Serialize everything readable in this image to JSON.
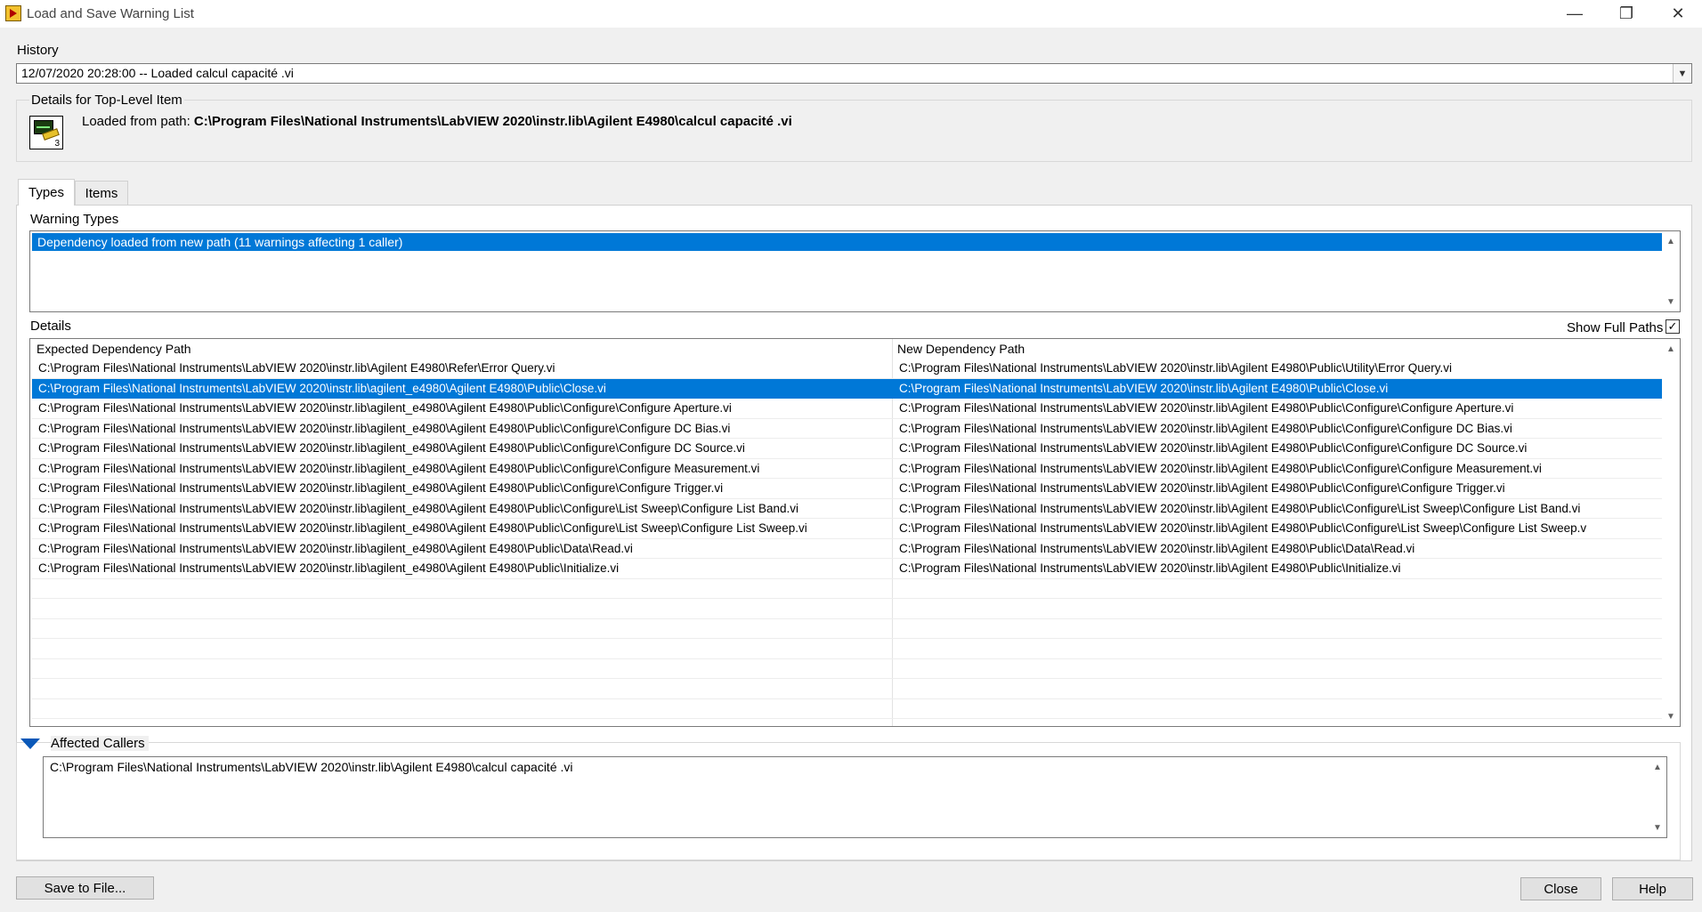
{
  "window": {
    "title": "Load and Save Warning List",
    "minimize_glyph": "—",
    "restore_glyph": "❐",
    "close_glyph": "✕"
  },
  "history": {
    "label": "History",
    "selected": "12/07/2020 20:28:00 -- Loaded calcul capacité .vi"
  },
  "top_level": {
    "label": "Details for Top-Level Item",
    "loaded_prefix": "Loaded from path: ",
    "path": "C:\\Program Files\\National Instruments\\LabVIEW 2020\\instr.lib\\Agilent E4980\\calcul capacité .vi",
    "icon_number": "3"
  },
  "tabs": [
    {
      "label": "Types",
      "selected": true
    },
    {
      "label": "Items",
      "selected": false
    }
  ],
  "warning_types": {
    "label": "Warning Types",
    "items": [
      "Dependency loaded from new path (11 warnings affecting 1 caller)"
    ]
  },
  "details": {
    "label": "Details",
    "show_full_paths_label": "Show Full Paths",
    "show_full_paths_checked": "✓",
    "columns": [
      "Expected Dependency Path",
      "New Dependency Path"
    ],
    "selected_row": 1,
    "rows": [
      [
        "C:\\Program Files\\National Instruments\\LabVIEW 2020\\instr.lib\\Agilent E4980\\Refer\\Error Query.vi",
        "C:\\Program Files\\National Instruments\\LabVIEW 2020\\instr.lib\\Agilent E4980\\Public\\Utility\\Error Query.vi"
      ],
      [
        "C:\\Program Files\\National Instruments\\LabVIEW 2020\\instr.lib\\agilent_e4980\\Agilent E4980\\Public\\Close.vi",
        "C:\\Program Files\\National Instruments\\LabVIEW 2020\\instr.lib\\Agilent E4980\\Public\\Close.vi"
      ],
      [
        "C:\\Program Files\\National Instruments\\LabVIEW 2020\\instr.lib\\agilent_e4980\\Agilent E4980\\Public\\Configure\\Configure Aperture.vi",
        "C:\\Program Files\\National Instruments\\LabVIEW 2020\\instr.lib\\Agilent E4980\\Public\\Configure\\Configure Aperture.vi"
      ],
      [
        "C:\\Program Files\\National Instruments\\LabVIEW 2020\\instr.lib\\agilent_e4980\\Agilent E4980\\Public\\Configure\\Configure DC Bias.vi",
        "C:\\Program Files\\National Instruments\\LabVIEW 2020\\instr.lib\\Agilent E4980\\Public\\Configure\\Configure DC Bias.vi"
      ],
      [
        "C:\\Program Files\\National Instruments\\LabVIEW 2020\\instr.lib\\agilent_e4980\\Agilent E4980\\Public\\Configure\\Configure DC Source.vi",
        "C:\\Program Files\\National Instruments\\LabVIEW 2020\\instr.lib\\Agilent E4980\\Public\\Configure\\Configure DC Source.vi"
      ],
      [
        "C:\\Program Files\\National Instruments\\LabVIEW 2020\\instr.lib\\agilent_e4980\\Agilent E4980\\Public\\Configure\\Configure Measurement.vi",
        "C:\\Program Files\\National Instruments\\LabVIEW 2020\\instr.lib\\Agilent E4980\\Public\\Configure\\Configure Measurement.vi"
      ],
      [
        "C:\\Program Files\\National Instruments\\LabVIEW 2020\\instr.lib\\agilent_e4980\\Agilent E4980\\Public\\Configure\\Configure Trigger.vi",
        "C:\\Program Files\\National Instruments\\LabVIEW 2020\\instr.lib\\Agilent E4980\\Public\\Configure\\Configure Trigger.vi"
      ],
      [
        "C:\\Program Files\\National Instruments\\LabVIEW 2020\\instr.lib\\agilent_e4980\\Agilent E4980\\Public\\Configure\\List Sweep\\Configure List Band.vi",
        "C:\\Program Files\\National Instruments\\LabVIEW 2020\\instr.lib\\Agilent E4980\\Public\\Configure\\List Sweep\\Configure List Band.vi"
      ],
      [
        "C:\\Program Files\\National Instruments\\LabVIEW 2020\\instr.lib\\agilent_e4980\\Agilent E4980\\Public\\Configure\\List Sweep\\Configure List Sweep.vi",
        "C:\\Program Files\\National Instruments\\LabVIEW 2020\\instr.lib\\Agilent E4980\\Public\\Configure\\List Sweep\\Configure List Sweep.v"
      ],
      [
        "C:\\Program Files\\National Instruments\\LabVIEW 2020\\instr.lib\\agilent_e4980\\Agilent E4980\\Public\\Data\\Read.vi",
        "C:\\Program Files\\National Instruments\\LabVIEW 2020\\instr.lib\\Agilent E4980\\Public\\Data\\Read.vi"
      ],
      [
        "C:\\Program Files\\National Instruments\\LabVIEW 2020\\instr.lib\\agilent_e4980\\Agilent E4980\\Public\\Initialize.vi",
        "C:\\Program Files\\National Instruments\\LabVIEW 2020\\instr.lib\\Agilent E4980\\Public\\Initialize.vi"
      ]
    ]
  },
  "affected_callers": {
    "label": "Affected Callers",
    "items": [
      "C:\\Program Files\\National Instruments\\LabVIEW 2020\\instr.lib\\Agilent E4980\\calcul capacité .vi"
    ]
  },
  "buttons": {
    "save": "Save to File...",
    "close": "Close",
    "help": "Help"
  },
  "scroll_glyphs": {
    "up": "▲",
    "down": "▼",
    "combo": "⌄"
  }
}
